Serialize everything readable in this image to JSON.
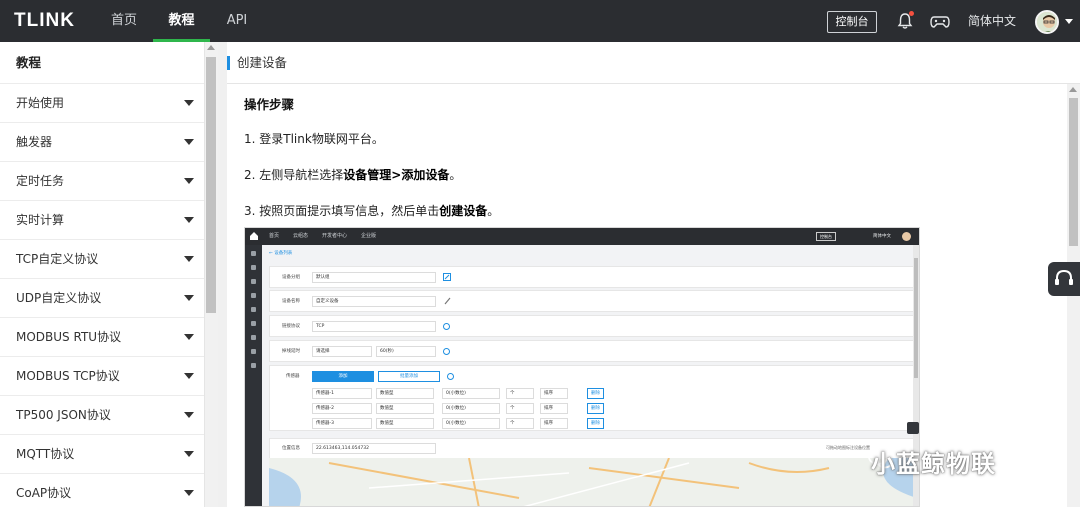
{
  "app": {
    "logo": "TLINK"
  },
  "topnav": {
    "items": [
      {
        "label": "首页",
        "active": false
      },
      {
        "label": "教程",
        "active": true
      },
      {
        "label": "API",
        "active": false
      }
    ],
    "console_label": "控制台",
    "language": "简体中文",
    "accent": "#2fb64c"
  },
  "sidebar": {
    "title": "教程",
    "items": [
      {
        "label": "开始使用"
      },
      {
        "label": "触发器"
      },
      {
        "label": "定时任务"
      },
      {
        "label": "实时计算"
      },
      {
        "label": "TCP自定义协议"
      },
      {
        "label": "UDP自定义协议"
      },
      {
        "label": "MODBUS RTU协议"
      },
      {
        "label": "MODBUS TCP协议"
      },
      {
        "label": "TP500 JSON协议"
      },
      {
        "label": "MQTT协议"
      },
      {
        "label": "CoAP协议"
      }
    ]
  },
  "page": {
    "title": "创建设备",
    "section_title": "操作步骤",
    "steps": [
      {
        "text": "1. 登录Tlink物联网平台。"
      },
      {
        "pre": "2. 左侧导航栏选择",
        "bold": "设备管理>添加设备",
        "post": "。"
      },
      {
        "pre": "3. 按照页面提示填写信息，然后单击",
        "bold": "创建设备",
        "post": "。"
      }
    ]
  },
  "screenshot": {
    "nav": [
      "首页",
      "云组态",
      "开发者中心",
      "企业版"
    ],
    "console": "控制台",
    "lang": "简体中文",
    "back": "设备列表",
    "rows": {
      "group_label": "设备分组",
      "group_value": "默认组",
      "name_label": "设备名称",
      "name_value": "自定义设备",
      "protocol_label": "链接协议",
      "protocol_value": "TCP",
      "timeout_label": "掉线延时",
      "timeout_value1": "请选择",
      "timeout_value2": "60(秒)",
      "sensor_label": "传感器",
      "add_btn": "添加",
      "batch_btn": "批量添加",
      "location_label": "位置信息",
      "location_value": "22.613463,114.054732",
      "location_hint": "可拖动地图标注设备位置"
    },
    "sensors": [
      {
        "name": "传感器-1",
        "type": "数值型",
        "decimal": "0(小数位)",
        "unit": "个",
        "order": "排序",
        "del": "删除"
      },
      {
        "name": "传感器-2",
        "type": "数值型",
        "decimal": "0(小数位)",
        "unit": "个",
        "order": "排序",
        "del": "删除"
      },
      {
        "name": "传感器-3",
        "type": "数值型",
        "decimal": "0(小数位)",
        "unit": "个",
        "order": "排序",
        "del": "删除"
      }
    ]
  },
  "watermark": "小蓝鲸物联"
}
